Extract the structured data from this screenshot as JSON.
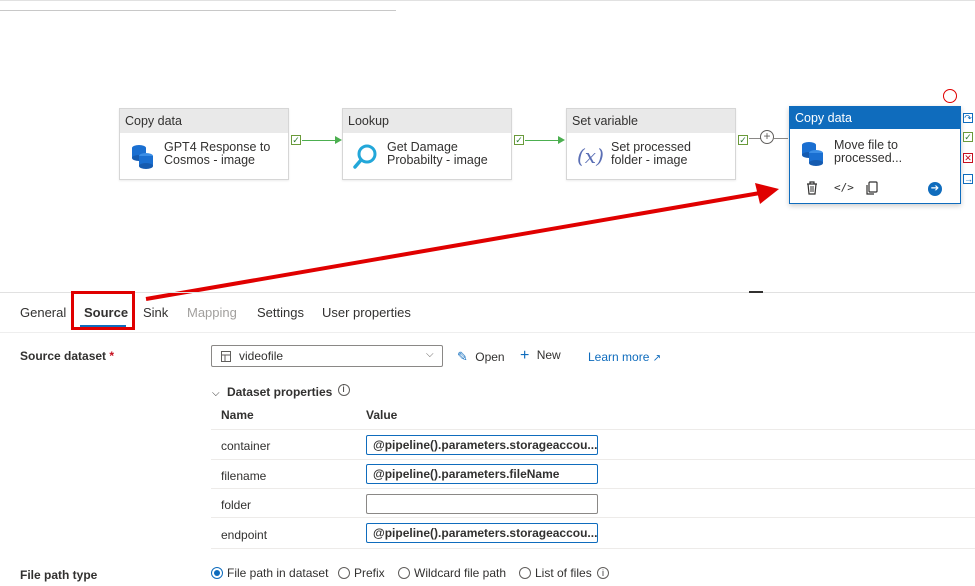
{
  "pipeline": {
    "nodes": [
      {
        "type": "Copy data",
        "name": "GPT4 Response to Cosmos - image",
        "line1": "GPT4 Response to",
        "line2": "Cosmos - image",
        "icon": "database-icon"
      },
      {
        "type": "Lookup",
        "name": "Get Damage Probabilty - image",
        "line1": "Get Damage",
        "line2": "Probabilty - image",
        "icon": "magnifier-icon"
      },
      {
        "type": "Set variable",
        "name": "Set processed folder - image",
        "line1": "Set processed",
        "line2": "folder - image",
        "icon": "variable-icon"
      },
      {
        "type": "Copy data",
        "name": "Move file to processed...",
        "line1": "Move file to",
        "line2": "processed...",
        "icon": "database-icon",
        "selected": true
      }
    ],
    "node_actions": [
      "delete-icon",
      "code-icon",
      "copy-icon",
      "go-icon"
    ],
    "colors": {
      "accent": "#0f6cbd",
      "success": "#4caf50",
      "annotation": "#e00000"
    }
  },
  "tabs": [
    {
      "label": "General"
    },
    {
      "label": "Source",
      "active": true
    },
    {
      "label": "Sink"
    },
    {
      "label": "Mapping",
      "disabled": true
    },
    {
      "label": "Settings"
    },
    {
      "label": "User properties"
    }
  ],
  "source": {
    "dataset_label": "Source dataset",
    "required_mark": "*",
    "dataset_value": "videofile",
    "open_label": "Open",
    "new_label": "New",
    "learn_more": "Learn more",
    "dataset_properties_label": "Dataset properties",
    "columns": {
      "name": "Name",
      "value": "Value"
    },
    "properties": [
      {
        "name": "container",
        "value": "@pipeline().parameters.storageaccou..."
      },
      {
        "name": "filename",
        "value": "@pipeline().parameters.fileName"
      },
      {
        "name": "folder",
        "value": ""
      },
      {
        "name": "endpoint",
        "value": "@pipeline().parameters.storageaccou..."
      }
    ],
    "file_path_type_label": "File path type",
    "file_path_options": [
      {
        "label": "File path in dataset",
        "selected": true
      },
      {
        "label": "Prefix"
      },
      {
        "label": "Wildcard file path"
      },
      {
        "label": "List of files"
      }
    ]
  }
}
